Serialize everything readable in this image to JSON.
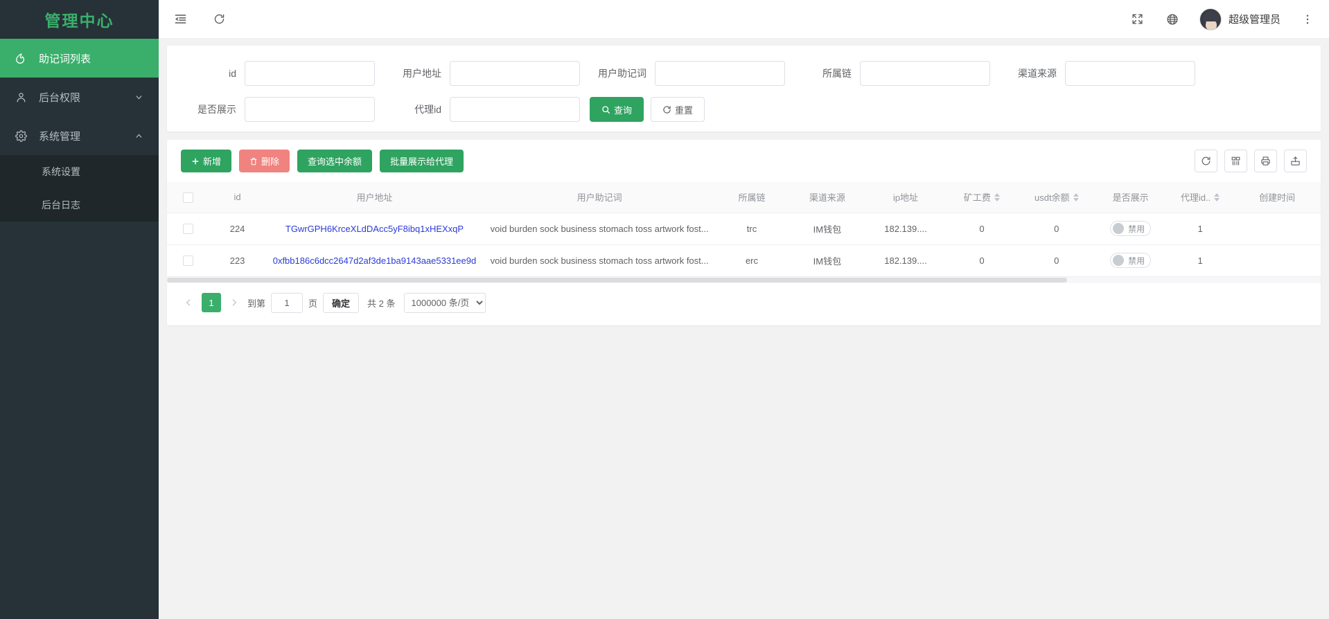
{
  "brand": {
    "title": "管理中心"
  },
  "sidebar": {
    "items": [
      {
        "label": "助记词列表",
        "icon": "fire-icon",
        "active": true,
        "arrow": ""
      },
      {
        "label": "后台权限",
        "icon": "user-icon",
        "active": false,
        "arrow": "chevron-down-icon"
      },
      {
        "label": "系统管理",
        "icon": "gear-icon",
        "active": false,
        "arrow": "chevron-up-icon"
      }
    ],
    "submenu": [
      {
        "label": "系统设置"
      },
      {
        "label": "后台日志"
      }
    ]
  },
  "topbar": {
    "collapse_icon": "collapse-menu-icon",
    "refresh_icon": "refresh-icon",
    "fullscreen_icon": "fullscreen-icon",
    "language_icon": "globe-icon",
    "user_name": "超级管理员",
    "more_icon": "more-vertical-icon"
  },
  "search": {
    "fields": [
      {
        "label": "id",
        "value": "",
        "placeholder": ""
      },
      {
        "label": "用户地址",
        "value": "",
        "placeholder": ""
      },
      {
        "label": "用户助记词",
        "value": "",
        "placeholder": ""
      },
      {
        "label": "所属链",
        "value": "",
        "placeholder": ""
      },
      {
        "label": "渠道来源",
        "value": "",
        "placeholder": ""
      },
      {
        "label": "是否展示",
        "value": "",
        "placeholder": ""
      },
      {
        "label": "代理id",
        "value": "",
        "placeholder": ""
      }
    ],
    "query_label": "查询",
    "reset_label": "重置"
  },
  "toolbar": {
    "add_label": "新增",
    "delete_label": "删除",
    "query_balance_label": "查询选中余额",
    "batch_show_label": "批量展示给代理",
    "icons": [
      "refresh-icon",
      "columns-icon",
      "print-icon",
      "export-icon"
    ]
  },
  "table": {
    "columns": [
      {
        "label": "",
        "key": "select",
        "sortable": false
      },
      {
        "label": "id",
        "key": "id",
        "sortable": false
      },
      {
        "label": "用户地址",
        "key": "address",
        "sortable": false
      },
      {
        "label": "用户助记词",
        "key": "mnemonic",
        "sortable": false
      },
      {
        "label": "所属链",
        "key": "chain",
        "sortable": false
      },
      {
        "label": "渠道来源",
        "key": "channel",
        "sortable": false
      },
      {
        "label": "ip地址",
        "key": "ip",
        "sortable": false
      },
      {
        "label": "矿工费",
        "key": "gas",
        "sortable": true
      },
      {
        "label": "usdt余额",
        "key": "usdt",
        "sortable": true
      },
      {
        "label": "是否展示",
        "key": "shown",
        "sortable": false
      },
      {
        "label": "代理id..",
        "key": "agent",
        "sortable": true
      },
      {
        "label": "创建时间",
        "key": "created",
        "sortable": false
      }
    ],
    "rows": [
      {
        "id": "224",
        "address": "TGwrGPH6KrceXLdDAcc5yF8ibq1xHEXxqP",
        "mnemonic": "void burden sock business stomach toss artwork fost...",
        "chain": "trc",
        "channel": "IM钱包",
        "ip": "182.139....",
        "gas": "0",
        "usdt": "0",
        "shown": "禁用",
        "agent": "1",
        "created": ""
      },
      {
        "id": "223",
        "address": "0xfbb186c6dcc2647d2af3de1ba9143aae5331ee9d",
        "mnemonic": "void burden sock business stomach toss artwork fost...",
        "chain": "erc",
        "channel": "IM钱包",
        "ip": "182.139....",
        "gas": "0",
        "usdt": "0",
        "shown": "禁用",
        "agent": "1",
        "created": ""
      }
    ]
  },
  "pagination": {
    "prev_icon": "chevron-left-icon",
    "next_icon": "chevron-right-icon",
    "current_page": "1",
    "goto_label": "到第",
    "goto_value": "1",
    "page_unit": "页",
    "confirm_label": "确定",
    "total_label": "共 2 条",
    "page_size": "1000000 条/页"
  },
  "colors": {
    "accent_green": "#3aaf6b",
    "sidebar_bg": "#263238",
    "submenu_bg": "#1f272b",
    "danger": "#f0837f",
    "link_blue": "#2b3bd6",
    "page_bg": "#f2f2f2"
  }
}
